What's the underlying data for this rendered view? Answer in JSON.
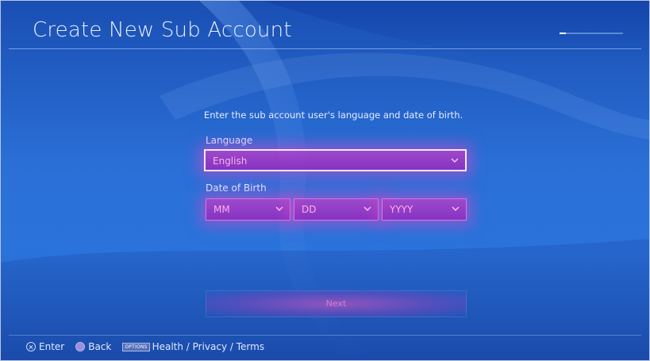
{
  "header": {
    "title": "Create New Sub Account",
    "progress_fraction": 0.1
  },
  "form": {
    "prompt": "Enter the sub account user's language and date of birth.",
    "language": {
      "label": "Language",
      "value": "English"
    },
    "date_of_birth": {
      "label": "Date of Birth",
      "month_placeholder": "MM",
      "day_placeholder": "DD",
      "year_placeholder": "YYYY"
    },
    "next_label": "Next"
  },
  "footer": {
    "enter_label": "Enter",
    "back_label": "Back",
    "options_icon_text": "OPTIONS",
    "terms_label": "Health / Privacy / Terms"
  },
  "colors": {
    "background": "#2a6fd6",
    "accent": "#c43cc8",
    "text": "#e4ecff"
  },
  "icons": [
    "cross-button-icon",
    "circle-button-icon",
    "options-button-icon",
    "chevron-down-icon"
  ]
}
